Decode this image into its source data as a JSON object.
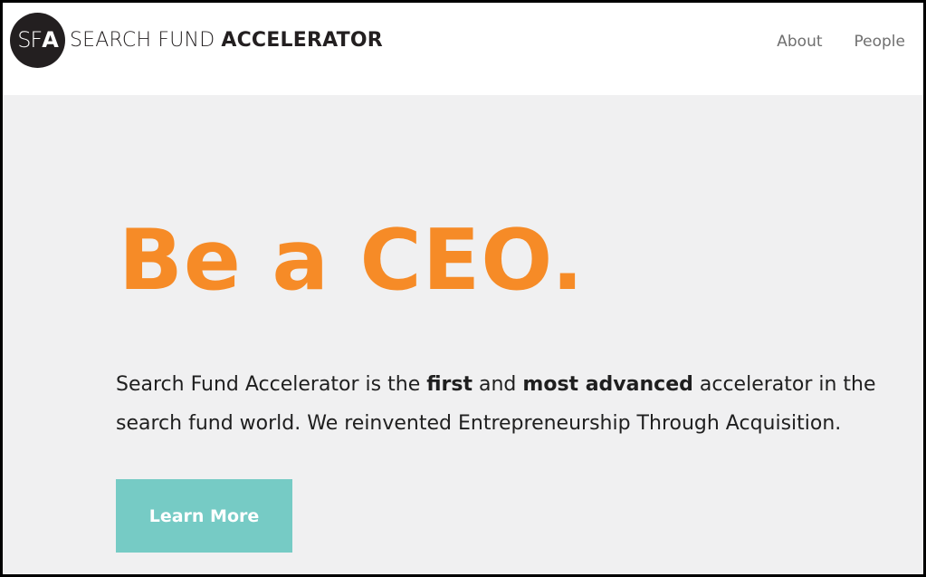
{
  "header": {
    "logo": {
      "badge_thin": "SF",
      "badge_bold": "A",
      "name_light": "SEARCH FUND",
      "name_bold": "ACCELERATOR"
    },
    "nav": [
      {
        "label": "About"
      },
      {
        "label": "People"
      }
    ]
  },
  "hero": {
    "title": "Be a CEO.",
    "text": {
      "part1": "Search Fund Accelerator is the ",
      "bold1": "first",
      "part2": " and ",
      "bold2": "most advanced",
      "part3": " accelerator in the search fund world. We reinvented Entrepreneurship Through Acquisition."
    },
    "cta_label": "Learn More"
  },
  "colors": {
    "accent": "#f68b27",
    "button": "#76cbc5",
    "background": "#f0f0f1"
  }
}
